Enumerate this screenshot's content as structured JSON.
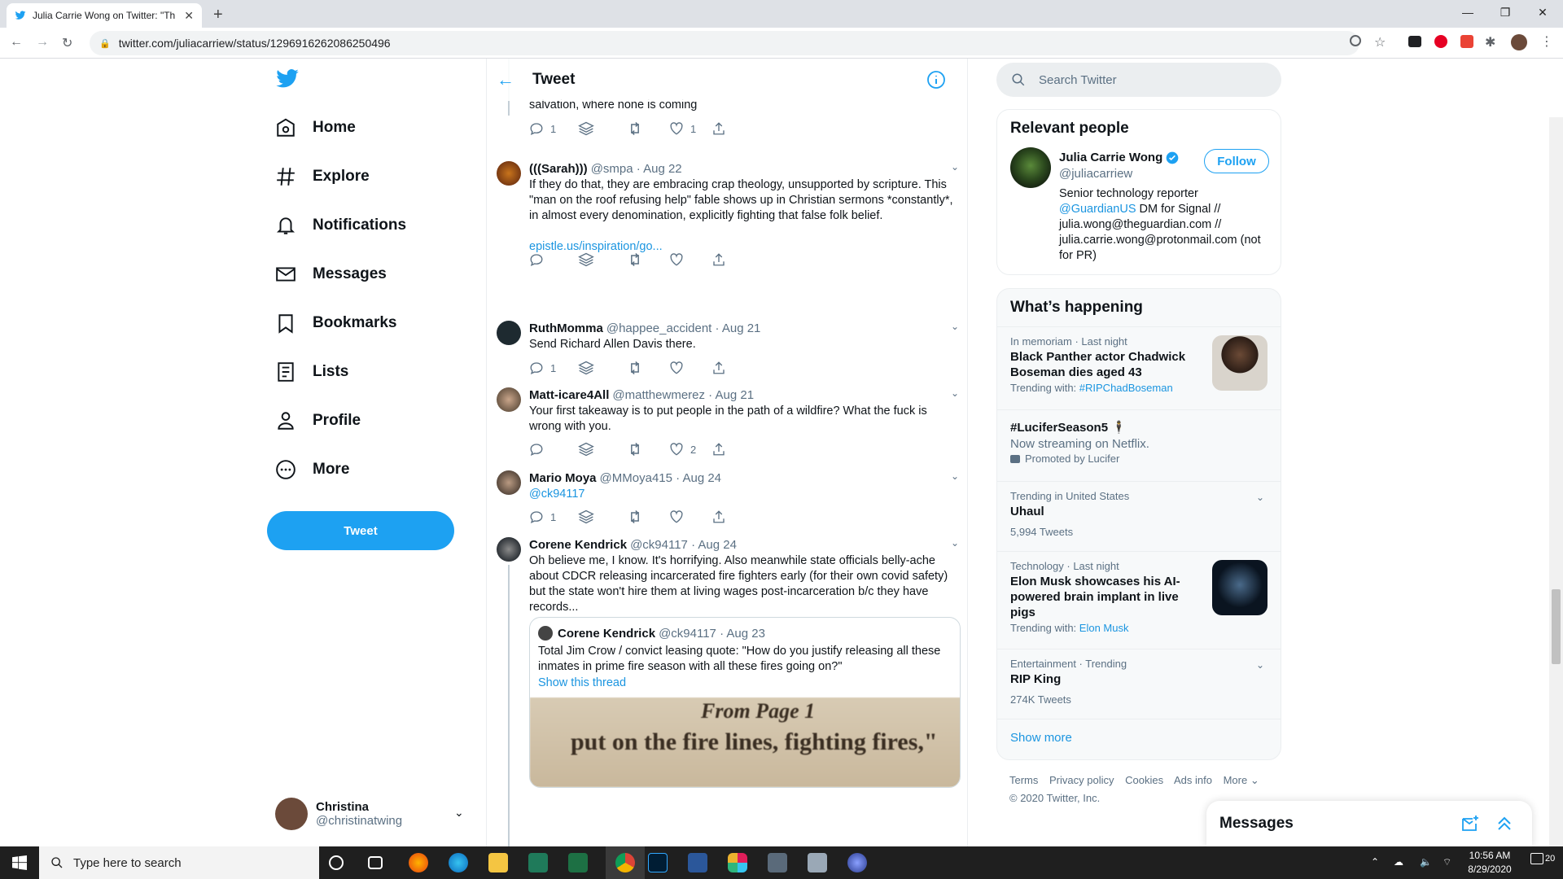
{
  "browser": {
    "tab_title": "Julia Carrie Wong on Twitter: \"Th",
    "new_tab": "+",
    "url": "twitter.com/juliacarriew/status/1296916262086250496"
  },
  "sidebar": {
    "items": [
      {
        "label": "Home",
        "icon": "home-icon"
      },
      {
        "label": "Explore",
        "icon": "hashtag-icon"
      },
      {
        "label": "Notifications",
        "icon": "bell-icon"
      },
      {
        "label": "Messages",
        "icon": "envelope-icon"
      },
      {
        "label": "Bookmarks",
        "icon": "bookmark-icon"
      },
      {
        "label": "Lists",
        "icon": "list-icon"
      },
      {
        "label": "Profile",
        "icon": "person-icon"
      },
      {
        "label": "More",
        "icon": "more-circle-icon"
      }
    ],
    "tweet_button": "Tweet",
    "account": {
      "name": "Christina",
      "handle": "@christinatwing"
    }
  },
  "timeline": {
    "header_title": "Tweet",
    "partial_tweet": {
      "text": "salvation, where none is coming",
      "reply_count": "1",
      "like_count": "1"
    },
    "tweets": [
      {
        "name": "(((Sarah)))",
        "meta": "@smpa · Aug 22",
        "text": "If they do that, they are embracing crap theology, unsupported by scripture. This \"man on the roof refusing help\" fable shows up in Christian sermons *constantly*, in almost every denomination, explicitly fighting that false folk belief.",
        "link": "epistle.us/inspiration/go...",
        "reply_count": "",
        "like_count": ""
      },
      {
        "name": "RuthMomma",
        "meta": "@happee_accident · Aug 21",
        "text": "Send Richard Allen Davis there.",
        "reply_count": "1",
        "like_count": ""
      },
      {
        "name": "Matt-icare4All",
        "meta": "@matthewmerez · Aug 21",
        "text": "Your first takeaway is to put people in the path of a wildfire? What the fuck is wrong with you.",
        "reply_count": "",
        "like_count": "2"
      },
      {
        "name": "Mario Moya",
        "meta": "@MMoya415 · Aug 24",
        "text": "@ck94117",
        "reply_count": "1",
        "like_count": ""
      },
      {
        "name": "Corene Kendrick",
        "meta": "@ck94117 · Aug 24",
        "text": "Oh believe me, I know. It's horrifying. Also meanwhile state officials belly-ache about CDCR releasing incarcerated fire fighters early (for their own covid safety) but the state won't hire them at living wages post-incarceration b/c they have records...",
        "quote": {
          "name": "Corene Kendrick",
          "meta": "@ck94117 · Aug 23",
          "text": "Total Jim Crow / convict leasing quote: \"How do you justify releasing all these inmates in prime fire season with all these fires going on?\"",
          "link": "Show this thread",
          "image_line1": "From Page 1",
          "image_line2": "put on the fire lines, fighting fires,\""
        }
      }
    ]
  },
  "right": {
    "search_placeholder": "Search Twitter",
    "relevant": {
      "title": "Relevant people",
      "name": "Julia Carrie Wong",
      "handle": "@juliacarriew",
      "follow": "Follow",
      "bio_pre": "Senior technology reporter ",
      "bio_link": "@GuardianUS",
      "bio_post": " DM for Signal // julia.wong@theguardian.com // julia.carrie.wong@protonmail.com (not for PR)"
    },
    "happening": {
      "title": "What’s happening",
      "trends": [
        {
          "sub": "In memoriam · Last night",
          "title": "Black Panther actor Chadwick Boseman dies aged 43",
          "with_label": "Trending with: ",
          "with_link": "#RIPChadBoseman"
        },
        {
          "sub": "",
          "title": "#LuciferSeason5 🕴",
          "desc": "Now streaming on Netflix.",
          "promoted": "Promoted by Lucifer"
        },
        {
          "sub": "Trending in United States",
          "title": "Uhaul",
          "count": "5,994 Tweets"
        },
        {
          "sub": "Technology · Last night",
          "title": "Elon Musk showcases his AI-powered brain implant in live pigs",
          "with_label": "Trending with: ",
          "with_link": "Elon Musk"
        },
        {
          "sub": "Entertainment · Trending",
          "title": "RIP King",
          "count": "274K Tweets"
        }
      ],
      "show_more": "Show more"
    },
    "footer": {
      "links": [
        "Terms",
        "Privacy policy",
        "Cookies",
        "Ads info",
        "More ⌄"
      ],
      "copyright": "© 2020 Twitter, Inc."
    },
    "messages": "Messages"
  },
  "taskbar": {
    "search_placeholder": "Type here to search",
    "time": "10:56 AM",
    "date": "8/29/2020",
    "notif_count": "20"
  }
}
